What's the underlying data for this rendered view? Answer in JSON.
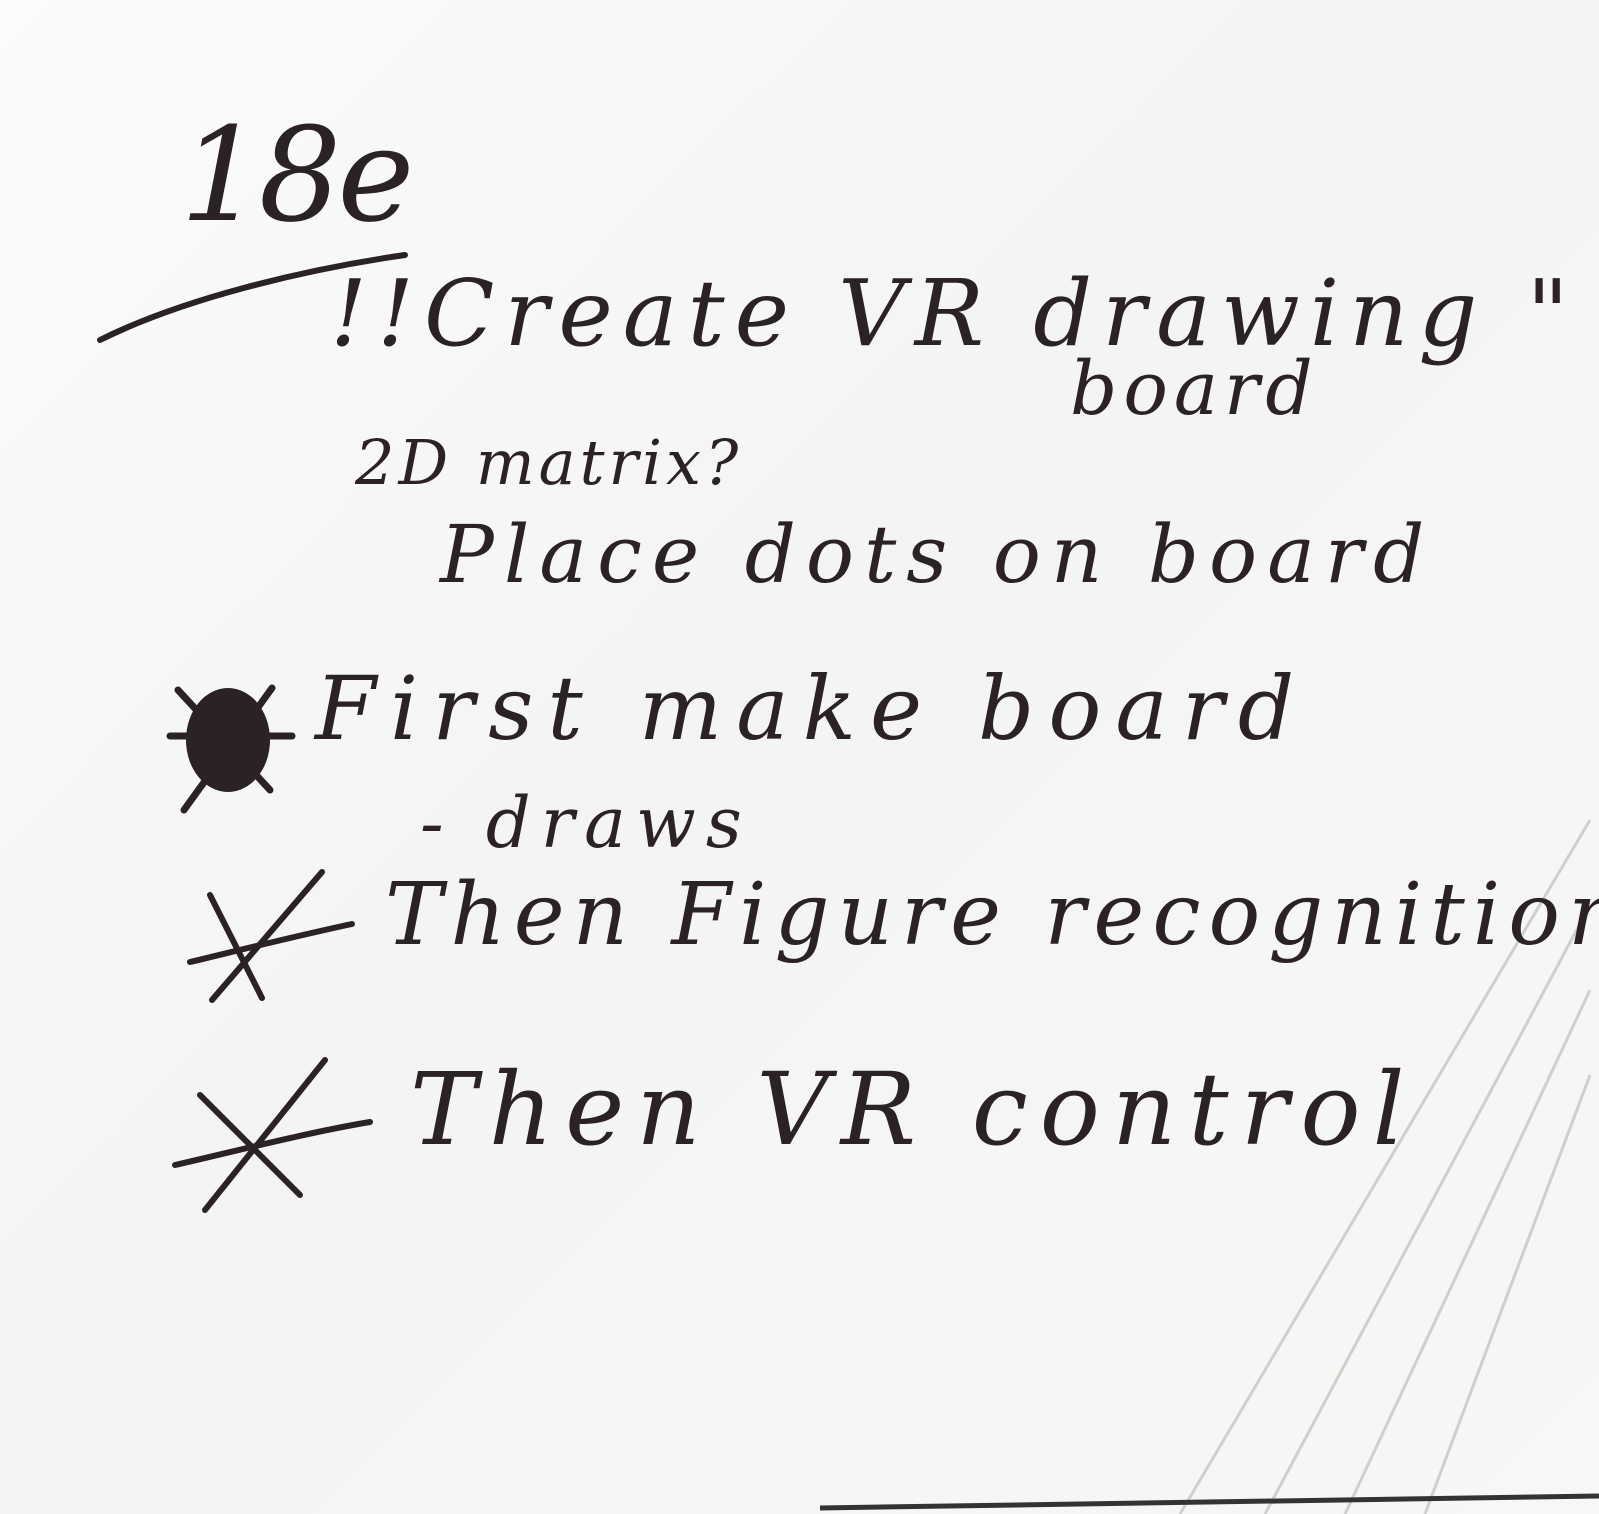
{
  "note": {
    "page_number": "18e",
    "lines": [
      "!!Create VR drawing \"",
      "board",
      "2D matrix?",
      "Place dots on board",
      "First make board",
      "- draws",
      "Then Figure recognition",
      "Then VR control"
    ]
  },
  "colors": {
    "ink": "#2a2226",
    "paper": "#f6f6f4"
  }
}
